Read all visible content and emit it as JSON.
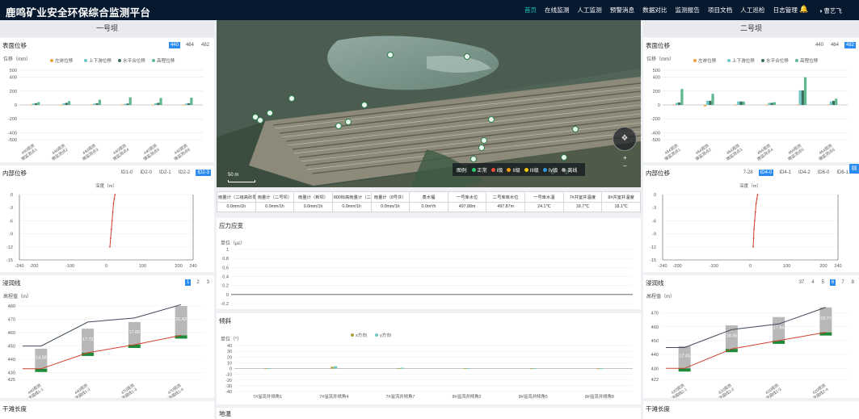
{
  "header": {
    "title": "鹿鸣矿业安全环保综合监测平台",
    "nav": [
      "首页",
      "在线监测",
      "人工监测",
      "预警消息",
      "数据对比",
      "监测报告",
      "项目文档",
      "人工巡检",
      "日志管理"
    ],
    "active_nav": 0,
    "bell_icon": "bell-icon",
    "user_icon": "user-icon",
    "user": "曹艺飞"
  },
  "left": {
    "dam_title": "一号坝",
    "surface": {
      "title": "表面位移",
      "tabs": [
        "440",
        "464",
        "482"
      ],
      "active_tab": 0,
      "unit": "位移（mm）",
      "legend": [
        "左岸位移",
        "上下游位移",
        "水平合位移",
        "高程位移"
      ],
      "yticks": [
        "500",
        "400",
        "200",
        "0",
        "-200",
        "-400",
        "-500"
      ],
      "xlabels": [
        "440观测\n墩监测点1",
        "440观测\n墩监测点2",
        "440观测\n墩监测点3",
        "440观测\n墩监测点4",
        "440观测\n墩监测点5",
        "440观测\n墩监测点6"
      ]
    },
    "internal": {
      "title": "内部位移",
      "tabs": [
        "ID1-0",
        "ID2-0",
        "ID2-1",
        "ID2-2",
        "ID2-3"
      ],
      "active_tab": 4,
      "depth": "深度（m）",
      "yticks": [
        "0",
        "-3",
        "-6",
        "-9",
        "-12",
        "-15"
      ],
      "xticks": [
        "-240",
        "-200",
        "-100",
        "0",
        "100",
        "200",
        "240"
      ]
    },
    "seepage": {
      "title": "浸润线",
      "tabs": [
        "1",
        "2",
        "3"
      ],
      "active_tab": 0,
      "unit": "高程值（m）",
      "yticks": [
        "480",
        "470",
        "460",
        "450",
        "440",
        "430",
        "425"
      ],
      "bar_labels": [
        "14.58",
        "17.73",
        "17.66",
        "21.43"
      ],
      "xlabels": [
        "440观测\n浸润线1-1",
        "440观测\n浸润线1-2",
        "470观测\n浸润线1-3",
        "470观测\n浸润线1-4"
      ]
    },
    "dry_beach": "干滩长度"
  },
  "right": {
    "dam_title": "二号坝",
    "surface": {
      "title": "表面位移",
      "tabs": [
        "440",
        "464",
        "482"
      ],
      "active_tab": 2,
      "unit": "位移（mm）",
      "legend": [
        "左岸位移",
        "上下游位移",
        "水平合位移",
        "高程位移"
      ],
      "yticks": [
        "500",
        "400",
        "200",
        "0",
        "-200",
        "-400",
        "-500"
      ],
      "xlabels": [
        "464观测\n墩监测点1",
        "464观测\n墩监测点2",
        "464观测\n墩监测点3",
        "464观测\n墩监测点4",
        "464观测\n墩监测点5",
        "464观测\n墩监测点6"
      ]
    },
    "internal": {
      "title": "内部位移",
      "tabs": [
        "7-28",
        "ID4-0",
        "ID4-1",
        "ID4-2",
        "ID6-0",
        "ID6-1",
        "ID"
      ],
      "active_tab": 1,
      "depth": "深度（m）",
      "yticks": [
        "0",
        "-3",
        "-6",
        "-9",
        "-12",
        "-15"
      ],
      "xticks": [
        "-240",
        "-200",
        "-100",
        "0",
        "100",
        "200",
        "240"
      ]
    },
    "seepage": {
      "title": "浸润线",
      "tabs": [
        "37",
        "4",
        "5",
        "6",
        "7",
        "8"
      ],
      "active_tab": 3,
      "unit": "高程值（m）",
      "yticks": [
        "470",
        "460",
        "450",
        "440",
        "430",
        "422"
      ],
      "bar_labels": [
        "17.45",
        "18.36",
        "17.84",
        "23.77"
      ],
      "xlabels": [
        "420观测\n浸润线2-1",
        "420观测\n浸润线2-2",
        "420观测\n浸润线2-3",
        "420观测\n浸润线2-4"
      ]
    },
    "dry_beach": "干滩长度"
  },
  "map": {
    "legend_title": "图例:",
    "legend": [
      {
        "label": "正常",
        "color": "#2ecc71"
      },
      {
        "label": "I级",
        "color": "#e74c3c"
      },
      {
        "label": "II级",
        "color": "#f39c12"
      },
      {
        "label": "III级",
        "color": "#f1c40f"
      },
      {
        "label": "IV级",
        "color": "#3498db"
      },
      {
        "label": "离线",
        "color": "#aaaaaa"
      }
    ],
    "scale": "50 m",
    "compass_icon": "compass-icon",
    "zoom_in": "+",
    "zoom_out": "−"
  },
  "sensors": {
    "headers": [
      "雨量计（二级高砂泵站）",
      "雨量计（二号坝）",
      "雨量计（新坝）",
      "800标高雨量计（二号坝）",
      "雨量计（8号井）",
      "蒸水幅",
      "一号库水位",
      "二号库库水位",
      "一号库水温",
      "7#井室井温度",
      "8#井室井温度"
    ],
    "values": [
      "0.0mm/1h",
      "0.0mm/1h",
      "0.0mm/1h",
      "0.0mm/1h",
      "0.0mm/1h",
      "0.0m³/h",
      "497.88m",
      "497.87m",
      "24.1℃",
      "18.7℃",
      "18.1℃"
    ]
  },
  "stress": {
    "title": "应力应变",
    "unit": "单位（με）",
    "yticks": [
      "1",
      "0.8",
      "0.6",
      "0.4",
      "0.2",
      "0",
      "-0.2"
    ]
  },
  "tilt": {
    "title": "倾斜",
    "unit": "单位（°）",
    "legend": [
      "x方向",
      "y方向"
    ],
    "yticks": [
      "40",
      "30",
      "20",
      "10",
      "0",
      "-10",
      "-20",
      "-30",
      "-40"
    ],
    "xlabels": [
      "7#溢流井倾角1",
      "7#溢流井倾角4",
      "7#溢流井倾角7",
      "8#溢流井倾角2",
      "8#溢流井倾角5",
      "8#溢流井倾角8"
    ]
  },
  "ground_temp": "地温",
  "side_button_icon": "panel-toggle-icon",
  "chart_data": [
    {
      "type": "bar",
      "title": "表面位移",
      "ylabel": "位移（mm）",
      "ylim": [
        -500,
        500
      ],
      "categories": [
        "440观测墩监测点1",
        "440观测墩监测点2",
        "440观测墩监测点3",
        "440观测墩监测点4",
        "440观测墩监测点5",
        "440观测墩监测点6"
      ],
      "series": [
        {
          "name": "左岸位移",
          "values": [
            5,
            3,
            4,
            4,
            3,
            3
          ]
        },
        {
          "name": "上下游位移",
          "values": [
            20,
            25,
            20,
            15,
            25,
            20
          ]
        },
        {
          "name": "水平合位移",
          "values": [
            25,
            30,
            25,
            20,
            30,
            25
          ]
        },
        {
          "name": "高程位移",
          "values": [
            40,
            55,
            75,
            110,
            100,
            105
          ]
        }
      ]
    },
    {
      "type": "line",
      "title": "内部位移",
      "ylabel": "深度（m）",
      "xlim": [
        -240,
        240
      ],
      "ylim": [
        -15,
        0
      ],
      "x": [
        10,
        12,
        14,
        16,
        18,
        20,
        22,
        24
      ],
      "y": [
        -12,
        -10,
        -8,
        -6,
        -4,
        -2,
        -1,
        0
      ]
    },
    {
      "type": "bar",
      "title": "浸润线",
      "ylabel": "高程值（m）",
      "ylim": [
        425,
        480
      ],
      "categories": [
        "440观测浸润线1-1",
        "440观测浸润线1-2",
        "470观测浸润线1-3",
        "470观测浸润线1-4"
      ],
      "series": [
        {
          "name": "bottom",
          "values": [
            433,
            445,
            451,
            458
          ]
        },
        {
          "name": "top",
          "values": [
            448,
            463,
            468,
            480
          ]
        }
      ],
      "bar_labels": [
        "14.58",
        "17.73",
        "17.66",
        "21.43"
      ],
      "lines": [
        {
          "values": [
            450,
            468,
            471,
            481
          ]
        },
        {
          "values": [
            433,
            445,
            451,
            458
          ]
        }
      ]
    },
    {
      "type": "bar",
      "title": "表面位移",
      "ylabel": "位移（mm）",
      "ylim": [
        -500,
        500
      ],
      "categories": [
        "464观测墩监测点1",
        "464观测墩监测点2",
        "464观测墩监测点3",
        "464观测墩监测点4",
        "464观测墩监测点5",
        "464观测墩监测点6"
      ],
      "series": [
        {
          "name": "左岸位移",
          "values": [
            5,
            -20,
            3,
            3,
            5,
            5
          ]
        },
        {
          "name": "上下游位移",
          "values": [
            30,
            60,
            50,
            30,
            210,
            50
          ]
        },
        {
          "name": "水平合位移",
          "values": [
            35,
            60,
            50,
            30,
            210,
            60
          ]
        },
        {
          "name": "高程位移",
          "values": [
            230,
            160,
            50,
            40,
            400,
            90
          ]
        }
      ]
    },
    {
      "type": "line",
      "title": "内部位移",
      "ylabel": "深度（m）",
      "xlim": [
        -240,
        240
      ],
      "ylim": [
        -15,
        0
      ],
      "x": [
        8,
        9,
        10,
        12,
        14,
        16,
        18,
        20
      ],
      "y": [
        -12,
        -10,
        -8,
        -6,
        -4,
        -2,
        -1,
        0
      ]
    },
    {
      "type": "bar",
      "title": "浸润线",
      "ylabel": "高程值（m）",
      "ylim": [
        422,
        475
      ],
      "categories": [
        "420观测浸润线2-1",
        "420观测浸润线2-2",
        "420观测浸润线2-3",
        "420观测浸润线2-4"
      ],
      "series": [
        {
          "name": "bottom",
          "values": [
            430,
            444,
            450,
            456
          ]
        },
        {
          "name": "top",
          "values": [
            446,
            461,
            467,
            474
          ]
        }
      ],
      "bar_labels": [
        "17.45",
        "18.36",
        "17.84",
        "23.77"
      ],
      "lines": [
        {
          "values": [
            445,
            458,
            462,
            474
          ]
        },
        {
          "values": [
            430,
            444,
            450,
            456
          ]
        }
      ]
    },
    {
      "type": "bar",
      "title": "倾斜",
      "ylabel": "单位（°）",
      "ylim": [
        -40,
        40
      ],
      "categories": [
        "7#溢流井倾角1",
        "7#溢流井倾角4",
        "7#溢流井倾角7",
        "8#溢流井倾角2",
        "8#溢流井倾角5",
        "8#溢流井倾角8"
      ],
      "series": [
        {
          "name": "x方向",
          "values": [
            0.3,
            3,
            0.5,
            0.3,
            0.2,
            0.2
          ]
        },
        {
          "name": "y方向",
          "values": [
            0.5,
            4,
            1.5,
            0.6,
            0.3,
            0.2
          ]
        }
      ]
    }
  ]
}
